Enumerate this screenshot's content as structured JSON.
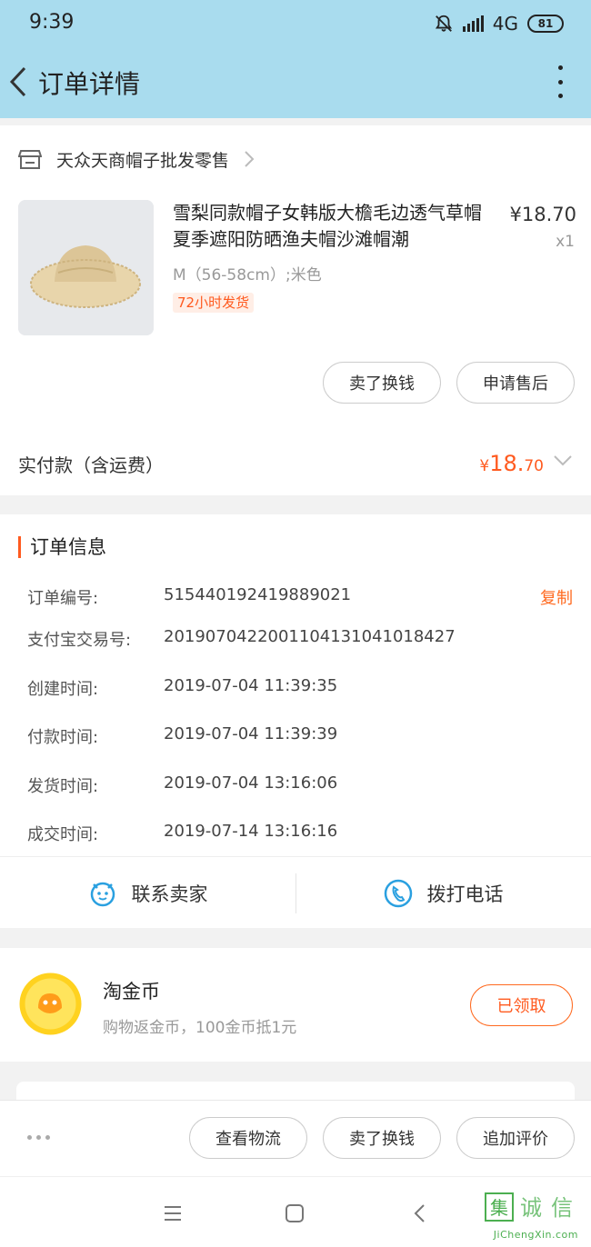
{
  "status_bar": {
    "time": "9:39",
    "network": "4G",
    "battery": "81"
  },
  "navbar": {
    "title": "订单详情"
  },
  "shop": {
    "name": "天众天商帽子批发零售"
  },
  "product": {
    "title": "雪梨同款帽子女韩版大檐毛边透气草帽夏季遮阳防晒渔夫帽沙滩帽潮",
    "price": "¥18.70",
    "quantity": "x1",
    "sku": "M（56-58cm）;米色",
    "tag": "72小时发货"
  },
  "item_actions": {
    "resell": "卖了换钱",
    "after_sale": "申请售后"
  },
  "payment": {
    "label": "实付款（含运费）",
    "currency": "¥",
    "amount_int": "18.",
    "amount_dec": "70"
  },
  "order_info": {
    "title": "订单信息",
    "copy_label": "复制",
    "rows": [
      {
        "label": "订单编号:",
        "value": "515440192419889021"
      },
      {
        "label": "支付宝交易号:",
        "value": "2019070422001104131041018427"
      },
      {
        "label": "创建时间:",
        "value": "2019-07-04 11:39:35"
      },
      {
        "label": "付款时间:",
        "value": "2019-07-04 11:39:39"
      },
      {
        "label": "发货时间:",
        "value": "2019-07-04 13:16:06"
      },
      {
        "label": "成交时间:",
        "value": "2019-07-14 13:16:16"
      }
    ]
  },
  "contact": {
    "seller": "联系卖家",
    "phone": "拨打电话"
  },
  "coins": {
    "title": "淘金币",
    "subtitle": "购物返金币，100金币抵1元",
    "button": "已领取"
  },
  "bottom_actions": {
    "logistics": "查看物流",
    "resell": "卖了换钱",
    "review": "追加评价"
  },
  "watermark": {
    "text": "JiChengXin.com",
    "logo": "集诚信"
  },
  "colors": {
    "header": "#a9dcee",
    "accent": "#ff5a1f",
    "contact_icon": "#2aa0e0",
    "coin": "#ffd21f"
  }
}
